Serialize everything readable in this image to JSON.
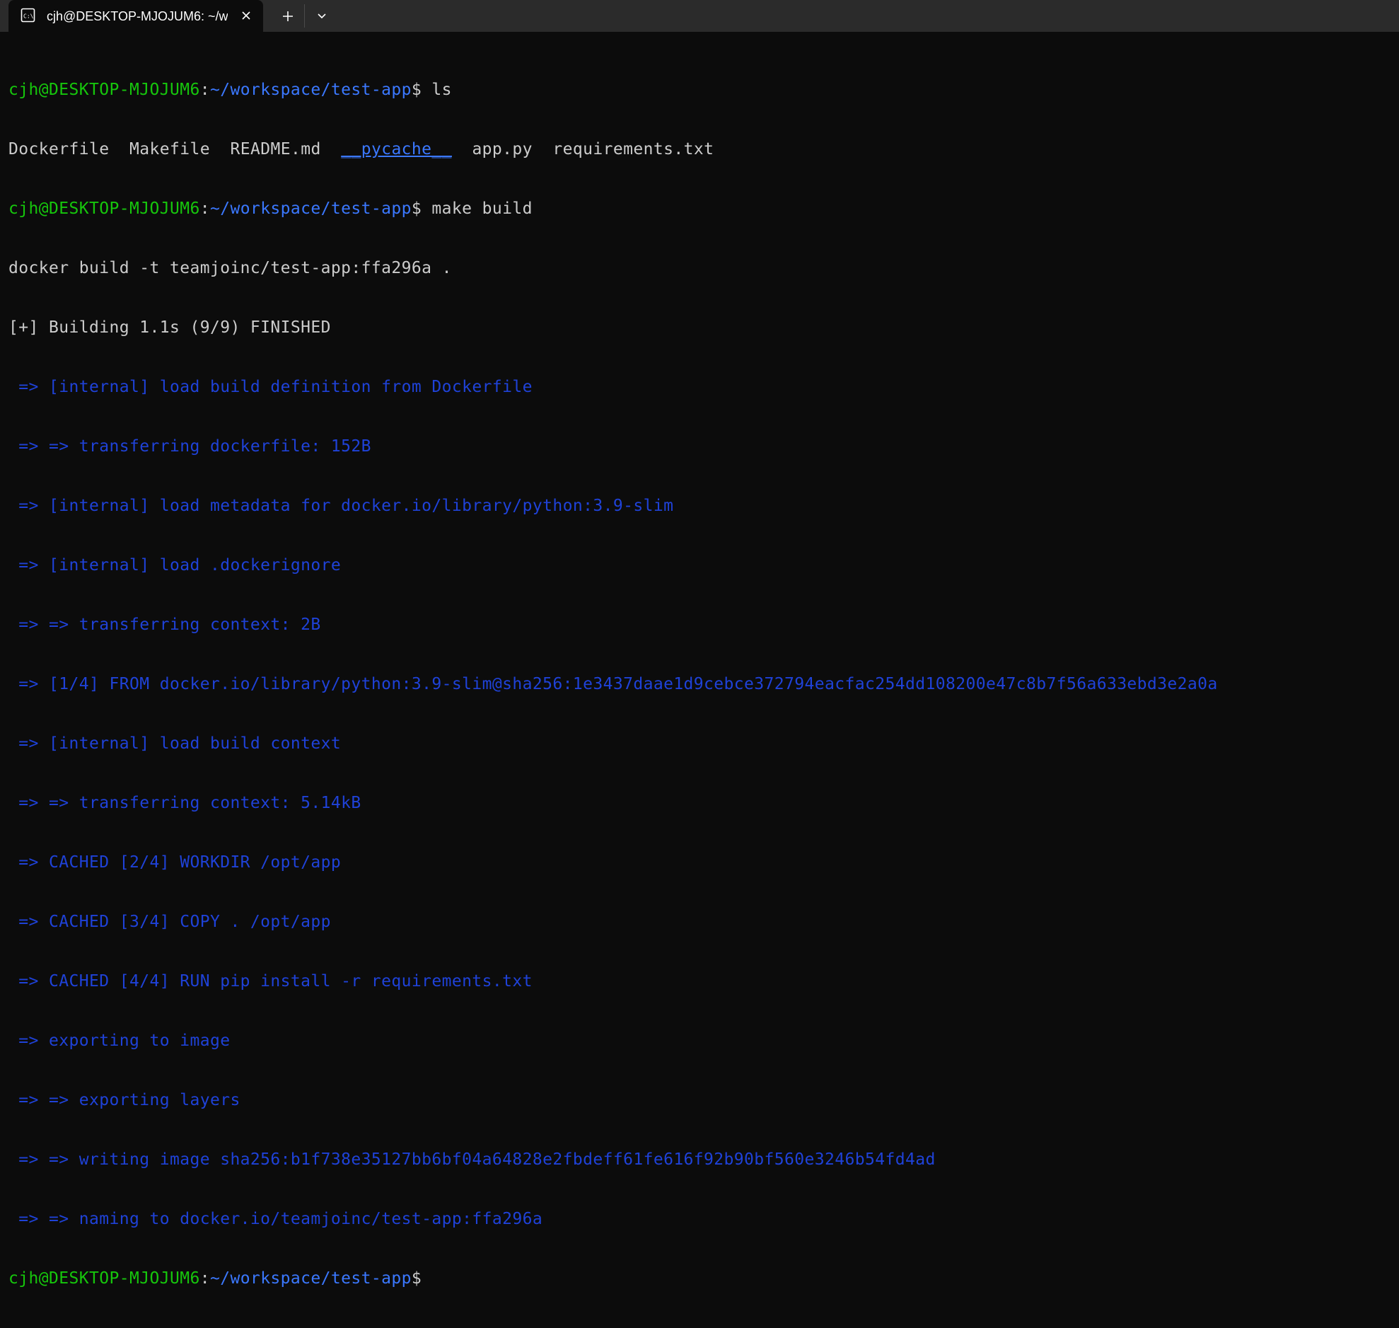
{
  "window": {
    "tab_title": "cjh@DESKTOP-MJOJUM6: ~/w",
    "tab_icon": "terminal-icon",
    "close_icon": "close-icon",
    "new_tab_icon": "plus-icon",
    "dropdown_icon": "chevron-down-icon"
  },
  "colors": {
    "background": "#0c0c0c",
    "titlebar": "#2b2b2b",
    "prompt_user": "#16c60c",
    "prompt_path": "#3b78ff",
    "build_output": "#1f42d8",
    "text": "#cccccc"
  },
  "terminal": {
    "prompt": {
      "user_host": "cjh@DESKTOP-MJOJUM6",
      "colon": ":",
      "path": "~/workspace/test-app",
      "symbol": "$"
    },
    "commands": {
      "first": " ls",
      "second": " make build"
    },
    "ls_output": {
      "dockerfile": "Dockerfile",
      "makefile": "Makefile",
      "readme": "README.md",
      "pycache": "__pycache__",
      "app": "app.py",
      "requirements": "requirements.txt"
    },
    "build_lines": [
      "docker build -t teamjoinc/test-app:ffa296a .",
      "[+] Building 1.1s (9/9) FINISHED"
    ],
    "build_steps": [
      " => [internal] load build definition from Dockerfile",
      " => => transferring dockerfile: 152B",
      " => [internal] load metadata for docker.io/library/python:3.9-slim",
      " => [internal] load .dockerignore",
      " => => transferring context: 2B",
      " => [1/4] FROM docker.io/library/python:3.9-slim@sha256:1e3437daae1d9cebce372794eacfac254dd108200e47c8b7f56a633ebd3e2a0a",
      " => [internal] load build context",
      " => => transferring context: 5.14kB",
      " => CACHED [2/4] WORKDIR /opt/app",
      " => CACHED [3/4] COPY . /opt/app",
      " => CACHED [4/4] RUN pip install -r requirements.txt",
      " => exporting to image",
      " => => exporting layers",
      " => => writing image sha256:b1f738e35127bb6bf04a64828e2fbdeff61fe616f92b90bf560e3246b54fd4ad",
      " => => naming to docker.io/teamjoinc/test-app:ffa296a"
    ]
  }
}
